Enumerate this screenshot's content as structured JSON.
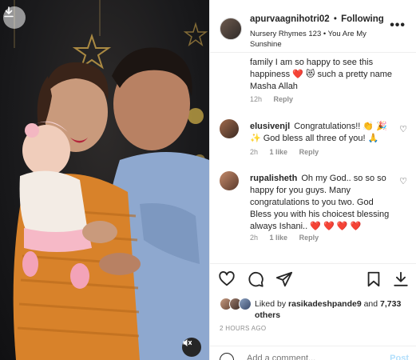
{
  "post": {
    "download_icon": "download-icon",
    "mute_icon": "speaker-muted-icon"
  },
  "header": {
    "username": "apurvaagnihotri02",
    "separator": "•",
    "follow_label": "Following",
    "audio": "Nursery Rhymes 123 • You Are My Sunshine",
    "more_icon": "more-horizontal-icon"
  },
  "comments": [
    {
      "username": "",
      "text": "family I am so happy to see this happiness ❤️ 😻 such a pretty name Masha Allah",
      "time": "12h",
      "likes": "",
      "reply": "Reply"
    },
    {
      "username": "elusivenjl",
      "text": "Congratulations!! 👏 🎉 ✨ God bless all three of you! 🙏",
      "time": "2h",
      "likes": "1 like",
      "reply": "Reply"
    },
    {
      "username": "rupalisheth",
      "text": "Oh my God.. so so so happy for you guys. Many congratulations to you two. God Bless you with his choicest blessing always Ishani.. ❤️ ❤️ ❤️ ❤️",
      "time": "2h",
      "likes": "1 like",
      "reply": "Reply"
    }
  ],
  "actions": {
    "like_icon": "heart-icon",
    "comment_icon": "comment-icon",
    "share_icon": "paper-plane-icon",
    "save_icon": "bookmark-icon",
    "download_icon": "download-icon"
  },
  "likes": {
    "prefix": "Liked by",
    "user": "rasikadeshpande9",
    "and": "and",
    "others": "7,733 others"
  },
  "timestamp": "2 HOURS AGO",
  "add_comment": {
    "placeholder": "Add a comment...",
    "post_label": "Post"
  },
  "colors": {
    "text": "#262626",
    "muted": "#8e8e8e",
    "border": "#efefef",
    "post_disabled": "#b2dffc",
    "heart_red": "#ed1c3c"
  }
}
